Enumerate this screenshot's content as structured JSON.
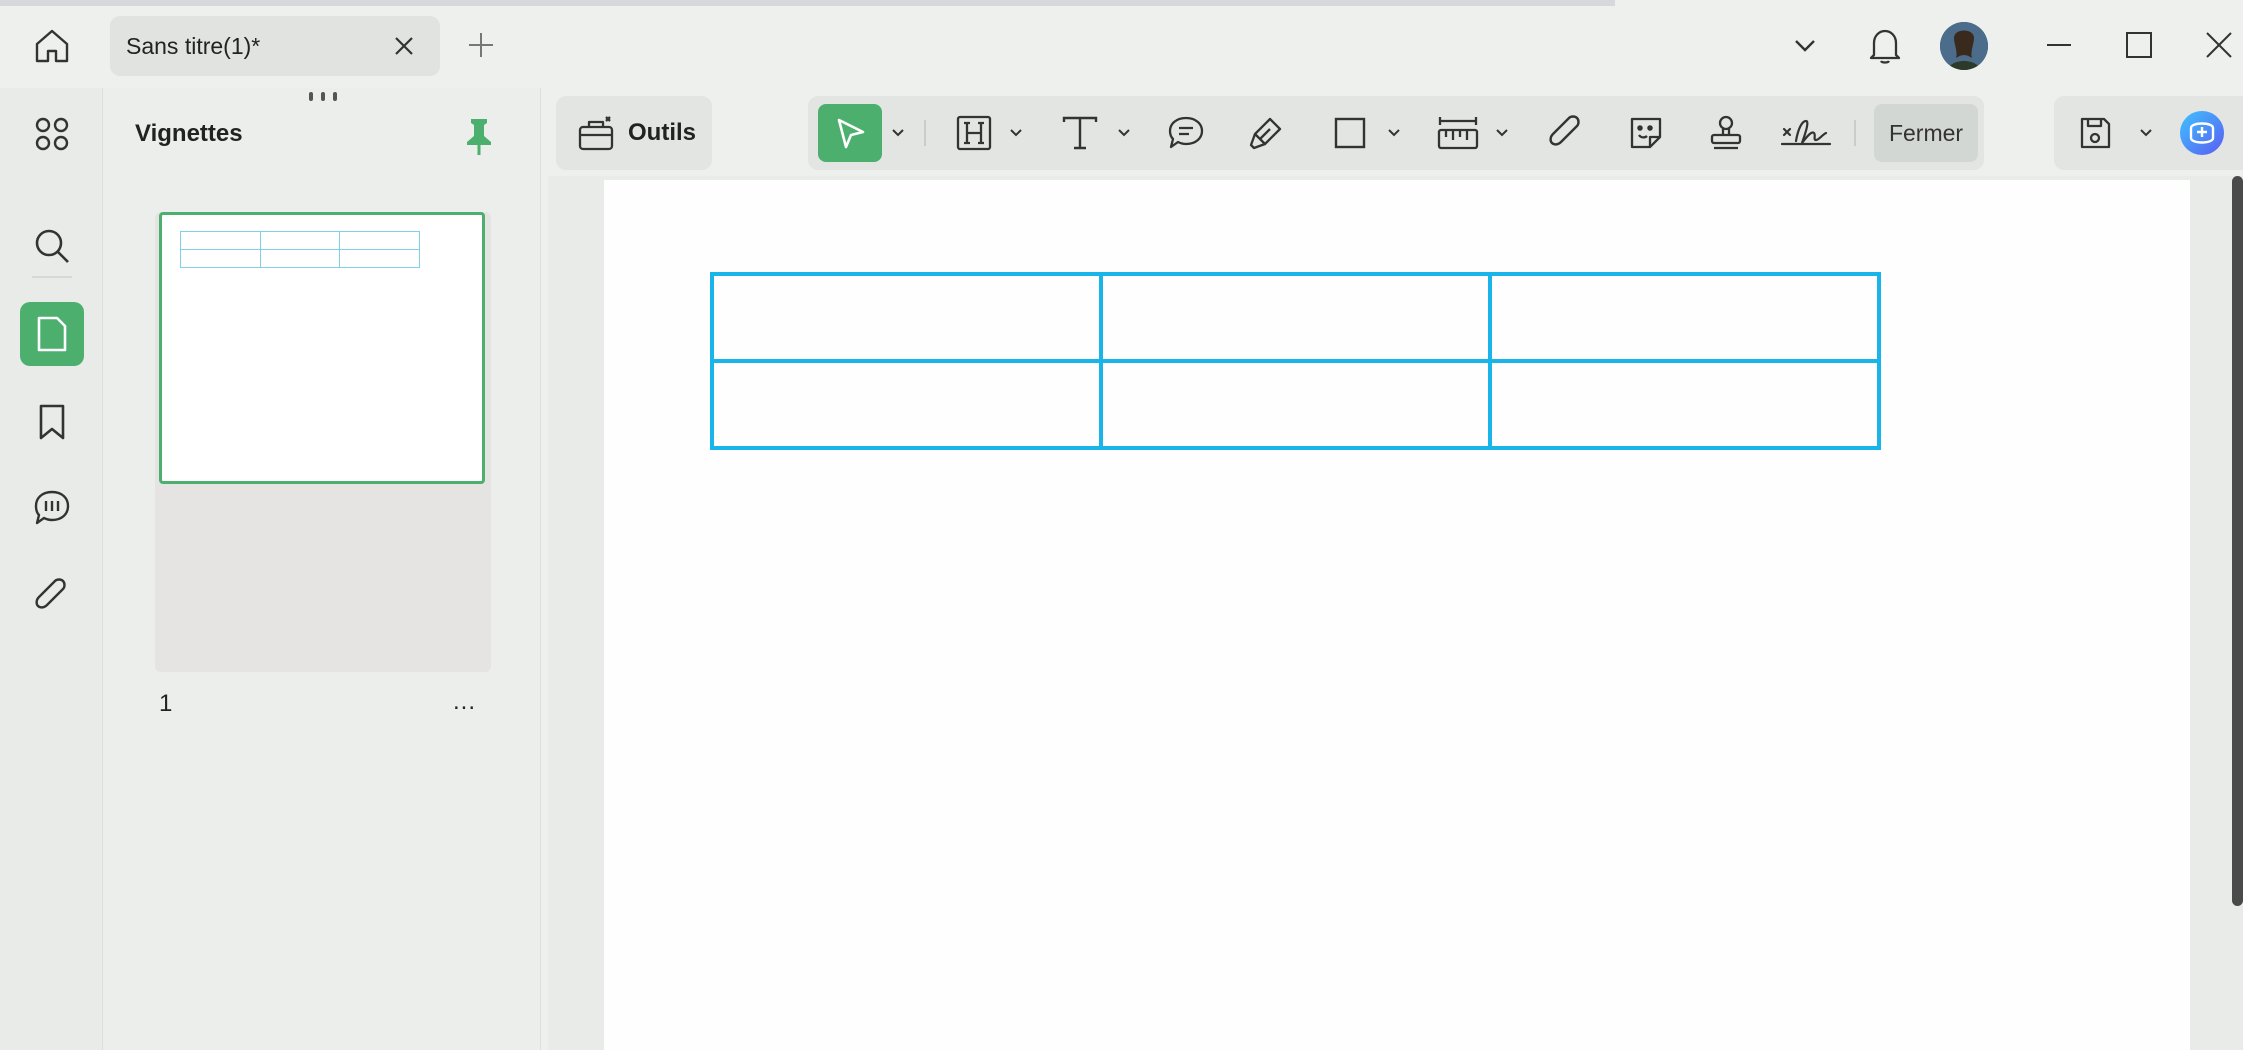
{
  "window": {
    "tab_title": "Sans titre(1)*"
  },
  "titlebar_icons": {
    "home": "home-icon",
    "close_tab": "close-icon",
    "new_tab": "plus-icon",
    "dropdown": "chevron-down-icon",
    "notifications": "bell-icon",
    "minimize": "minimize-icon",
    "maximize": "maximize-icon",
    "close_window": "close-icon"
  },
  "rail": {
    "items": [
      {
        "icon": "apps-grid-icon"
      },
      {
        "icon": "search-icon"
      },
      {
        "icon": "page-thumbnail-icon",
        "active": true
      },
      {
        "icon": "bookmark-icon"
      },
      {
        "icon": "comments-icon"
      },
      {
        "icon": "paperclip-icon"
      }
    ]
  },
  "panel": {
    "title": "Vignettes",
    "pin_icon": "pin-icon",
    "page_number": "1",
    "more_label": "..."
  },
  "toolbar": {
    "outils_label": "Outils",
    "fermer_label": "Fermer",
    "tools": [
      "select-arrow-icon",
      "heading-icon",
      "text-icon",
      "comment-icon",
      "highlighter-icon",
      "rectangle-icon",
      "measure-icon",
      "paperclip-icon",
      "sticker-icon",
      "stamp-icon",
      "signature-icon"
    ]
  },
  "colors": {
    "accent": "#4caf6e",
    "table_border": "#19b5ea"
  },
  "document": {
    "table": {
      "rows": 2,
      "cols": 3
    }
  }
}
